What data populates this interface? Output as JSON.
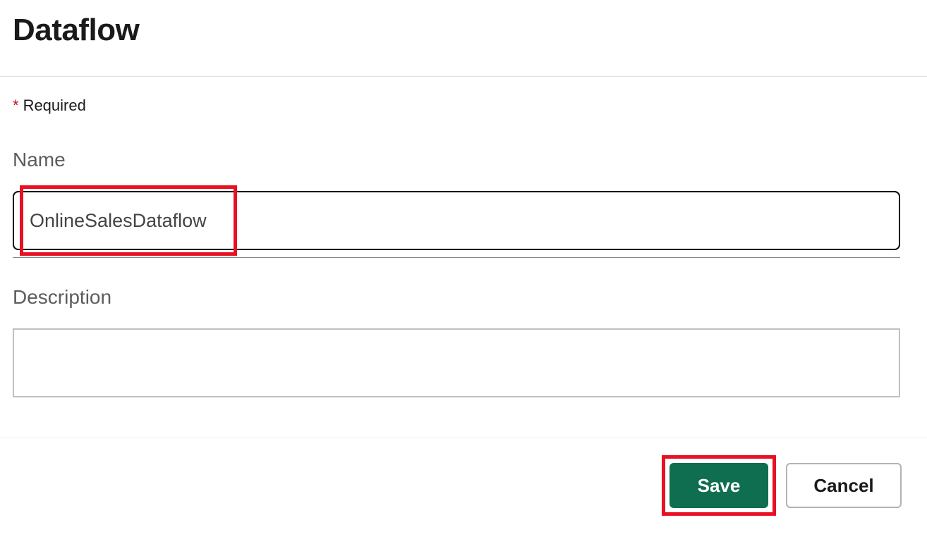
{
  "header": {
    "title": "Dataflow"
  },
  "form": {
    "required_label": "Required",
    "name_label": "Name",
    "name_value": "OnlineSalesDataflow",
    "description_label": "Description",
    "description_value": ""
  },
  "buttons": {
    "save": "Save",
    "cancel": "Cancel"
  },
  "colors": {
    "accent": "#0f6e4f",
    "highlight": "#e81123",
    "required_asterisk": "#c50e1f"
  }
}
